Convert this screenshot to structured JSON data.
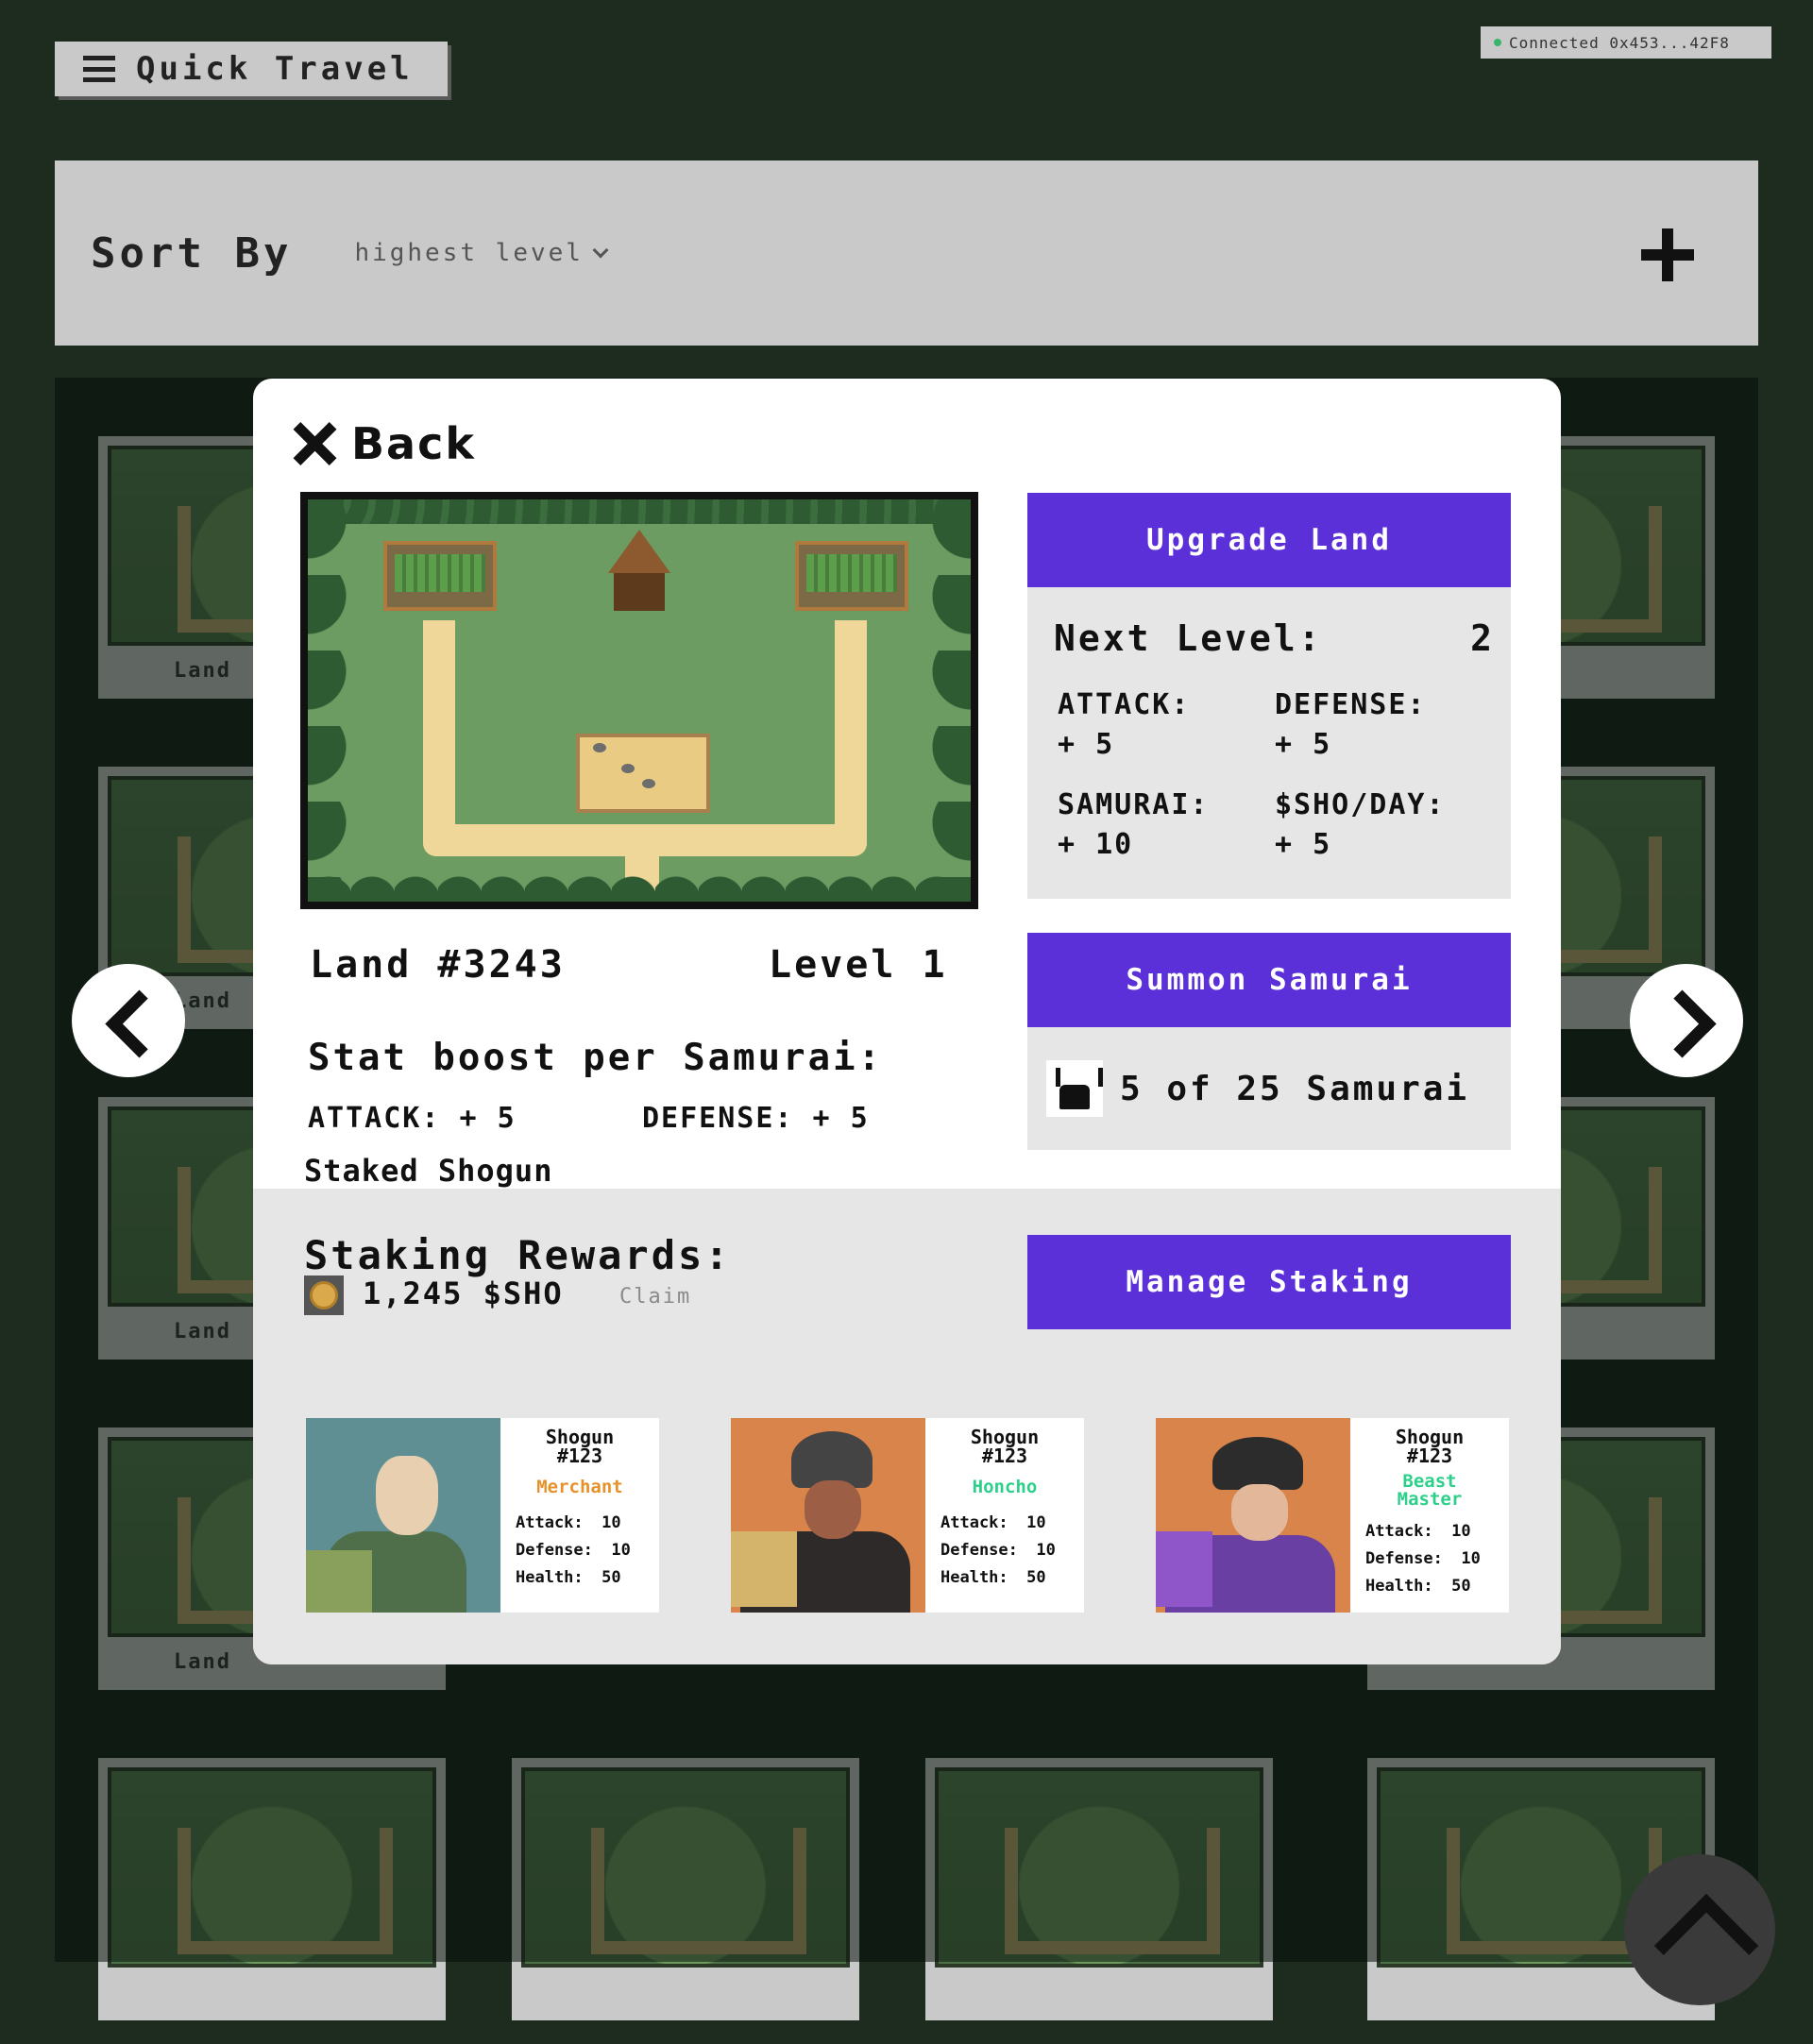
{
  "header": {
    "quick_travel_label": "Quick Travel",
    "wallet_status": "Connected 0x453...42F8"
  },
  "sort": {
    "label": "Sort By",
    "selected": "highest level"
  },
  "grid": {
    "card_label_prefix": "Land"
  },
  "modal": {
    "back_label": "Back",
    "land_name": "Land #3243",
    "land_level": "Level 1",
    "stat_heading": "Stat boost per Samurai:",
    "stat_attack": "ATTACK: + 5",
    "stat_defense": "DEFENSE: + 5",
    "staked_shogun_label": "Staked Shogun",
    "upgrade_button": "Upgrade Land",
    "next_level_label": "Next Level:",
    "next_level_value": "2",
    "next_level_stats": {
      "attack_label": "ATTACK:",
      "attack_value": "+ 5",
      "defense_label": "DEFENSE:",
      "defense_value": "+ 5",
      "samurai_label": "SAMURAI:",
      "samurai_value": "+ 10",
      "sho_label": "$SHO/DAY:",
      "sho_value": "+ 5"
    },
    "summon_button": "Summon Samurai",
    "samurai_count": "5 of 25 Samurai",
    "staking_heading": "Staking Rewards:",
    "rewards_value": "1,245 $SHO",
    "claim_label": "Claim",
    "manage_staking_button": "Manage Staking",
    "shoguns": [
      {
        "name": "Shogun\n#123",
        "role": "Merchant",
        "attack_label": "Attack:",
        "attack": "10",
        "defense_label": "Defense:",
        "defense": "10",
        "health_label": "Health:",
        "health": "50",
        "bg": "#5f8f93"
      },
      {
        "name": "Shogun\n#123",
        "role": "Honcho",
        "attack_label": "Attack:",
        "attack": "10",
        "defense_label": "Defense:",
        "defense": "10",
        "health_label": "Health:",
        "health": "50",
        "bg": "#d8844a"
      },
      {
        "name": "Shogun\n#123",
        "role": "Beast\nMaster",
        "attack_label": "Attack:",
        "attack": "10",
        "defense_label": "Defense:",
        "defense": "10",
        "health_label": "Health:",
        "health": "50",
        "bg": "#d8844a"
      }
    ]
  },
  "colors": {
    "accent": "#5b30d9",
    "merchant": "#e6922a",
    "honcho": "#2dd08a"
  }
}
